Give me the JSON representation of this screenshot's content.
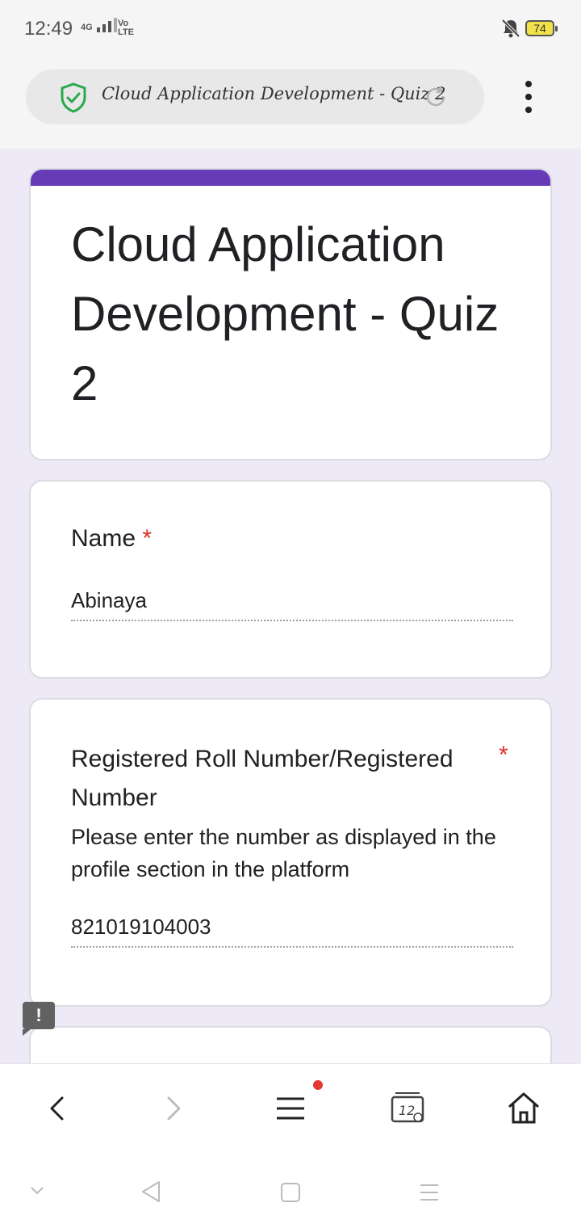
{
  "status": {
    "time": "12:49",
    "network": "4G",
    "volte": "Vo\nLTE",
    "battery": "74"
  },
  "browser": {
    "url_title": "Cloud Application Development - Quiz 2",
    "security_icon": "shield-check-icon",
    "reload_icon": "reload-icon",
    "menu_icon": "more-vert-icon"
  },
  "form": {
    "title": "Cloud Application Development - Quiz 2",
    "accent_color": "#673ab7",
    "questions": [
      {
        "label": "Name",
        "required_mark": "*",
        "answer": "Abinaya"
      },
      {
        "label": "Registered Roll Number/Registered Number",
        "required_mark": "*",
        "description": "Please enter the number as displayed in the profile section in the platform",
        "answer": "821019104003"
      }
    ],
    "feedback_icon": "!"
  },
  "toolbar": {
    "tabs_count": "12",
    "items": [
      "back-icon",
      "forward-icon",
      "menu-icon",
      "tabs-icon",
      "home-icon"
    ]
  },
  "android_nav": [
    "collapse-icon",
    "back-triangle-icon",
    "home-square-icon",
    "recents-icon"
  ]
}
